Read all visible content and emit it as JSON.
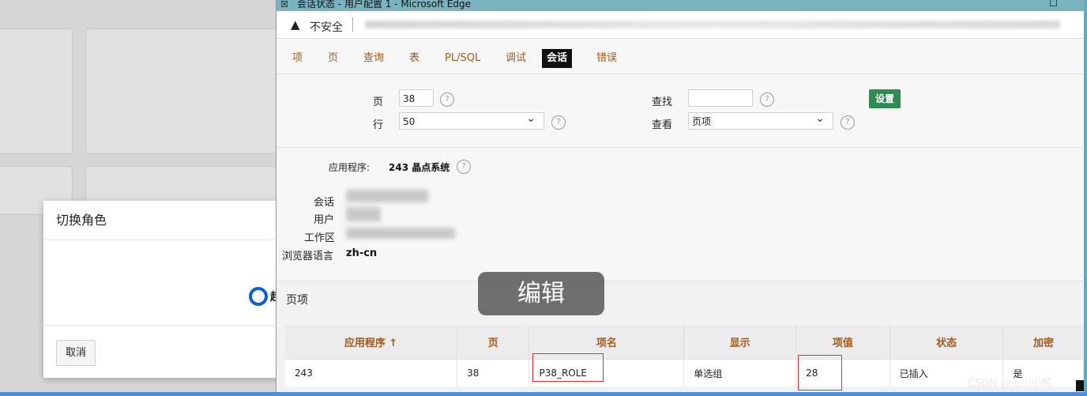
{
  "background": {
    "dialog": {
      "title": "切换角色",
      "radio_label": "超",
      "cancel_label": "取消"
    }
  },
  "window": {
    "title": "会话状态 - 用户配置 1 - Microsoft Edge",
    "address": {
      "security_label": "不安全"
    }
  },
  "tabs": [
    "项",
    "页",
    "查询",
    "表",
    "PL/SQL",
    "调试",
    "会话",
    "错误"
  ],
  "active_tab": "会话",
  "filters": {
    "page_label": "页",
    "page_value": "38",
    "rows_label": "行",
    "rows_value": "50",
    "find_label": "查找",
    "find_value": "",
    "view_label": "查看",
    "view_value": "页项",
    "set_button": "设置"
  },
  "info": {
    "app_label": "应用程序:",
    "app_value": "243 晶点系统",
    "session_label": "会话",
    "user_label": "用户",
    "workspace_label": "工作区",
    "browser_lang_label": "浏览器语言",
    "browser_lang_value": "zh-cn"
  },
  "section_title": "页项",
  "overlay_label": "编辑",
  "table": {
    "headers": [
      "应用程序 ↑",
      "页",
      "项名",
      "显示",
      "项值",
      "状态",
      "加密"
    ],
    "rows": [
      [
        "243",
        "38",
        "P38_ROLE",
        "单选组",
        "28",
        "已插入",
        "是"
      ]
    ]
  },
  "watermark": "CSDN @王小小鸭",
  "colors": {
    "accent_link": "#a05a1c",
    "active_tab_bg": "#111111",
    "set_button": "#2f8a54",
    "highlight_box": "#e23434",
    "titlebar": "#7ab3c0"
  }
}
